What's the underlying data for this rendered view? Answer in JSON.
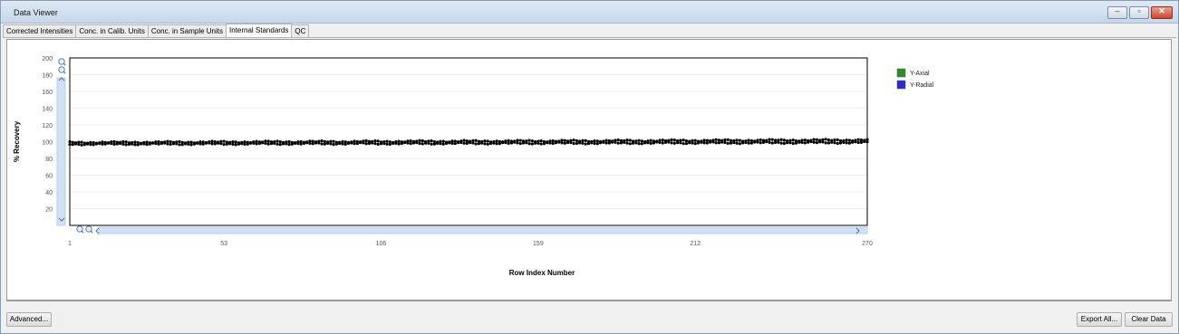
{
  "window": {
    "title": "Data Viewer"
  },
  "tabs": [
    {
      "label": "Corrected Intensities",
      "active": false
    },
    {
      "label": "Conc. in Calib. Units",
      "active": false
    },
    {
      "label": "Conc. in Sample Units",
      "active": false
    },
    {
      "label": "Internal Standards",
      "active": true
    },
    {
      "label": "QC",
      "active": false
    }
  ],
  "buttons": {
    "advanced": "Advanced...",
    "export_all": "Export All...",
    "clear_data": "Clear Data"
  },
  "icons": {
    "minimize": "minimize-icon",
    "restore": "restore-icon",
    "close": "close-icon",
    "zoom_in": "zoom-in-icon",
    "zoom_out": "zoom-out-icon"
  },
  "chart_data": {
    "type": "scatter",
    "title": "",
    "xlabel": "Row Index Number",
    "ylabel": "% Recovery",
    "xlim": [
      1,
      270
    ],
    "ylim": [
      0,
      200
    ],
    "x_ticks": [
      1,
      53,
      106,
      159,
      212,
      270
    ],
    "y_ticks": [
      20,
      40,
      60,
      80,
      100,
      120,
      140,
      160,
      180,
      200
    ],
    "grid": true,
    "legend_position": "right",
    "series": [
      {
        "name": "Y-Axial",
        "color": "#2e8b2e",
        "trend_start": 99,
        "trend_end": 102
      },
      {
        "name": "Y-Radial",
        "color": "#2a2ad0",
        "trend_start": 97,
        "trend_end": 99
      }
    ]
  }
}
